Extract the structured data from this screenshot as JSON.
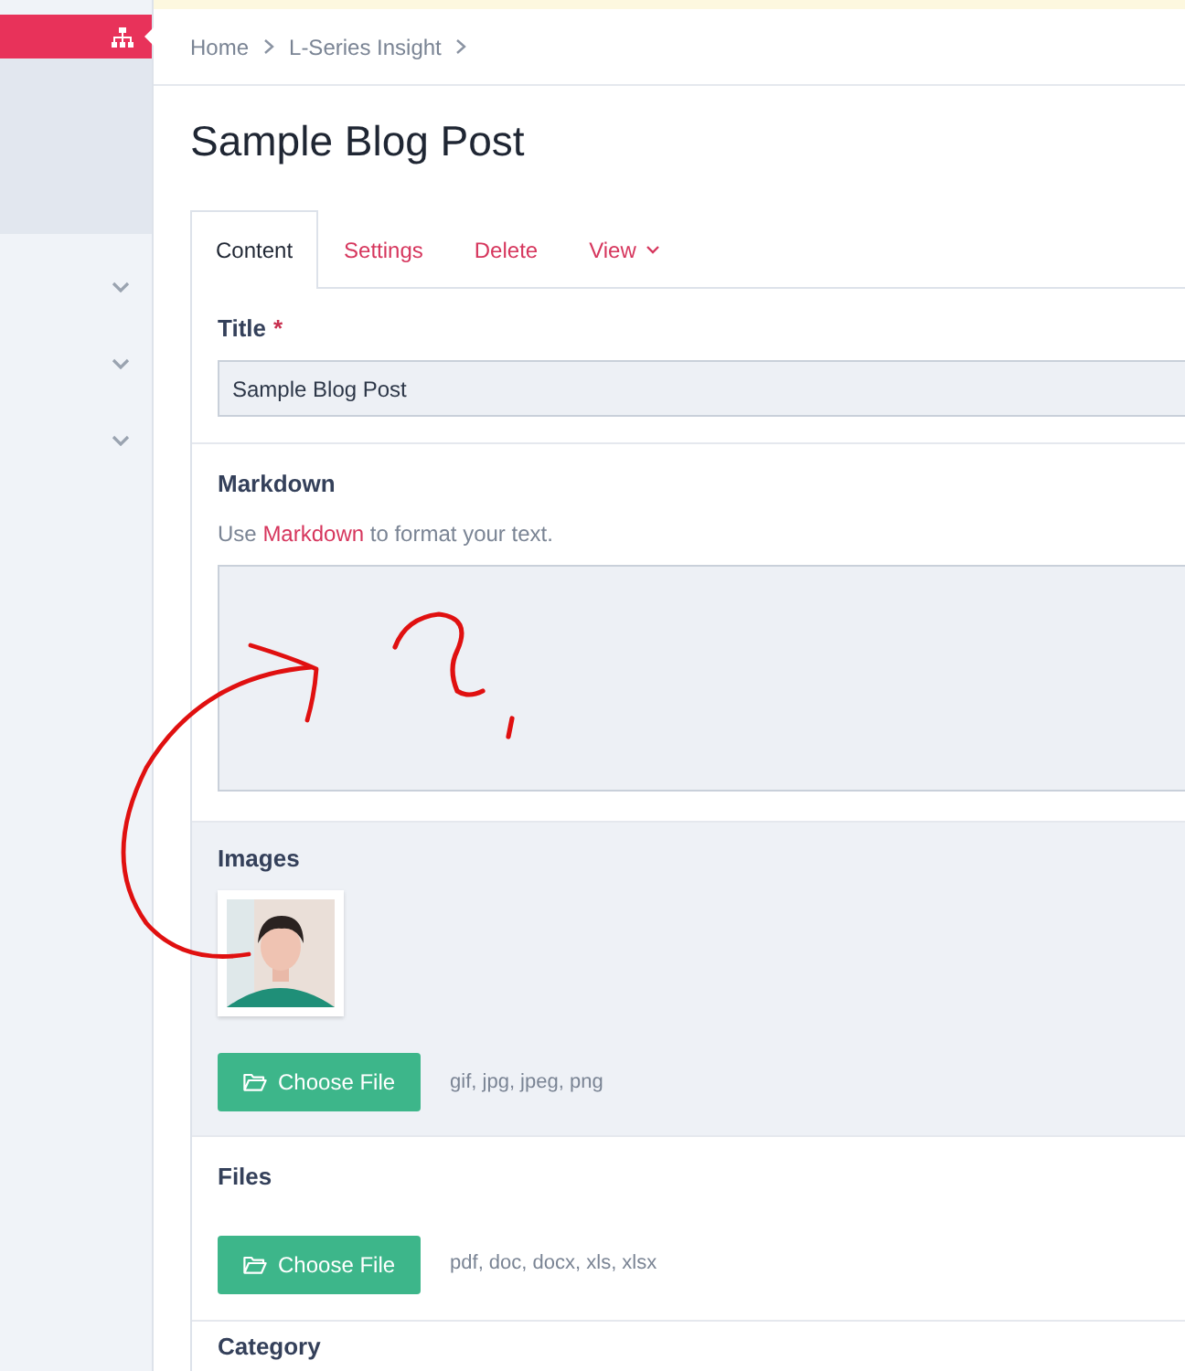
{
  "sidebar": {
    "active_item": {
      "selected": true
    },
    "groups": [
      {
        "expanded": false
      },
      {
        "expanded": false
      },
      {
        "expanded": false
      }
    ]
  },
  "breadcrumb": [
    "Home",
    "L-Series Insight"
  ],
  "page_title": "Sample Blog Post",
  "tabs": [
    {
      "label": "Content",
      "selected": true,
      "has_menu": false
    },
    {
      "label": "Settings",
      "selected": false,
      "has_menu": false
    },
    {
      "label": "Delete",
      "selected": false,
      "has_menu": false
    },
    {
      "label": "View",
      "selected": false,
      "has_menu": true
    }
  ],
  "sections": [
    {
      "kind": "text",
      "label": "Title",
      "required_mark": "*",
      "value": "Sample Blog Post"
    },
    {
      "kind": "markdown",
      "label": "Markdown",
      "help": [
        {
          "kind": "text",
          "text": "Use "
        },
        {
          "kind": "link",
          "text": "Markdown"
        },
        {
          "kind": "text",
          "text": " to format your text."
        }
      ]
    },
    {
      "kind": "upload",
      "label": "Images",
      "button": "Choose File",
      "types": "gif, jpg, jpeg, png"
    },
    {
      "kind": "upload",
      "label": "Files",
      "button": "Choose File",
      "types": "pdf, doc, docx, xls, xlsx"
    },
    {
      "kind": "heading",
      "label": "Category"
    }
  ]
}
